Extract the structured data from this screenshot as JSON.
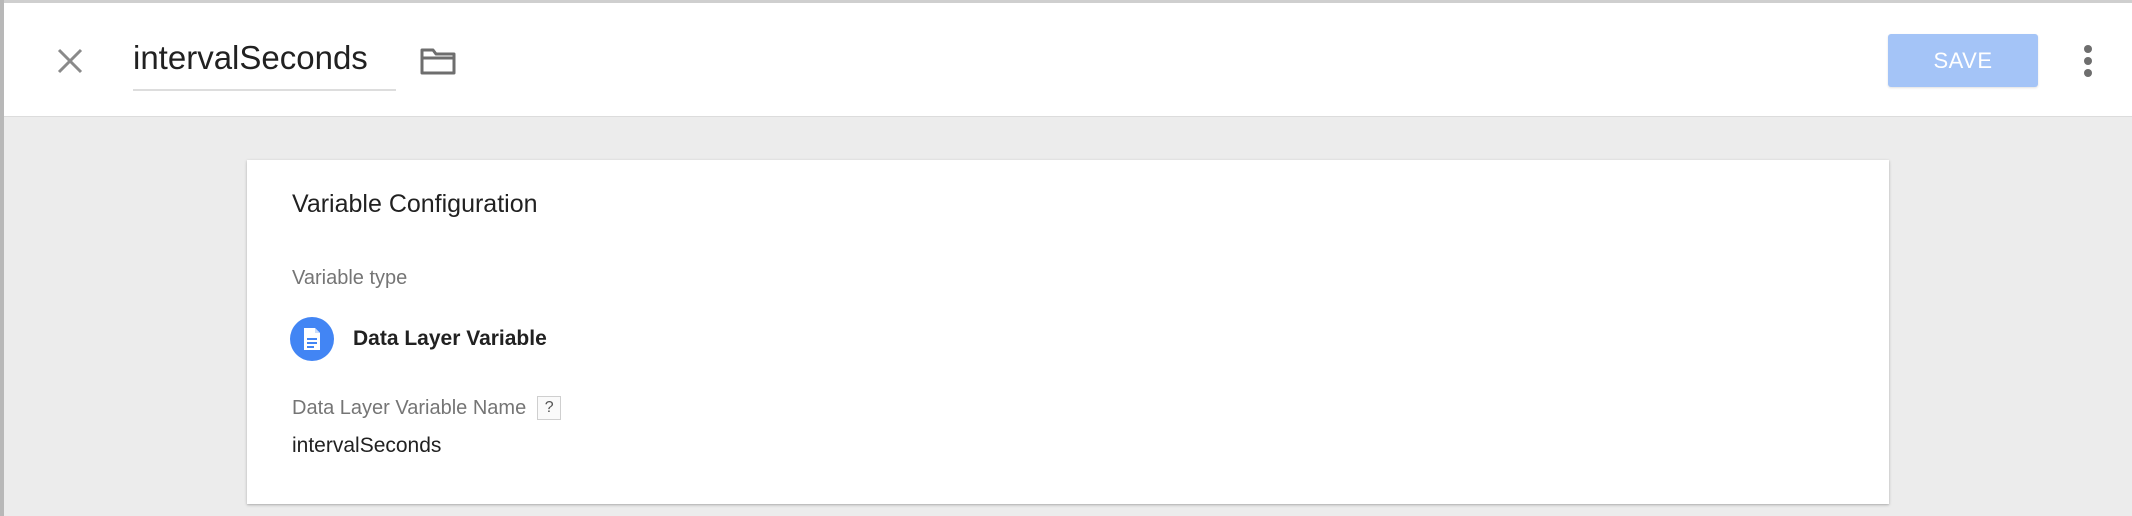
{
  "header": {
    "title": "intervalSeconds",
    "save_label": "SAVE",
    "icons": {
      "close": "close-icon",
      "folder": "folder-icon",
      "more": "more-vert-icon"
    },
    "colors": {
      "save_button_bg": "#a4c4f7",
      "save_button_text": "#ffffff"
    }
  },
  "card": {
    "title": "Variable Configuration",
    "variable_type_label": "Variable type",
    "variable_type": {
      "name": "Data Layer Variable",
      "icon": "document-icon",
      "icon_bg": "#4285f4"
    },
    "field_label": "Data Layer Variable Name",
    "help_glyph": "?",
    "field_value": "intervalSeconds"
  }
}
